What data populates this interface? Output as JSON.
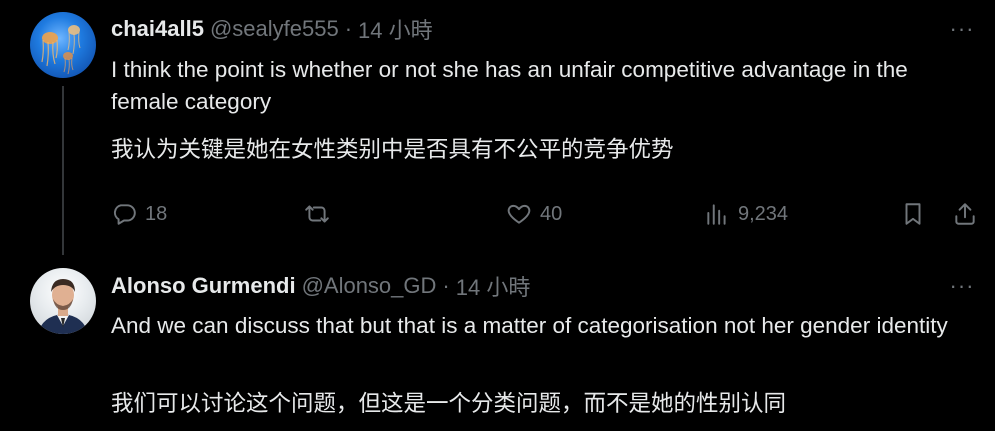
{
  "tweets": [
    {
      "name": "chai4all5",
      "handle": "@sealyfe555",
      "separator": "·",
      "time": "14 小時",
      "text_en": "I think the point is whether or not she has an unfair competitive advantage in the female category",
      "text_zh": "我认为关键是她在女性类别中是否具有不公平的竞争优势",
      "more": "···",
      "actions": {
        "replies": "18",
        "reposts": "",
        "likes": "40",
        "views": "9,234"
      }
    },
    {
      "name": "Alonso Gurmendi",
      "handle": "@Alonso_GD",
      "separator": "·",
      "time": "14 小時",
      "text_en": "And we can discuss that but that is a matter of categorisation not her gender identity",
      "text_zh": "我们可以讨论这个问题，但这是一个分类问题，而不是她的性别认同",
      "more": "···"
    }
  ],
  "icons": {
    "reply": "reply-icon",
    "repost": "repost-icon",
    "like": "heart-icon",
    "views": "views-icon",
    "bookmark": "bookmark-icon",
    "share": "share-icon",
    "more": "more-icon"
  },
  "colors": {
    "background": "#000000",
    "text": "#e7e9ea",
    "muted": "#71767b",
    "thread_line": "#333639"
  }
}
